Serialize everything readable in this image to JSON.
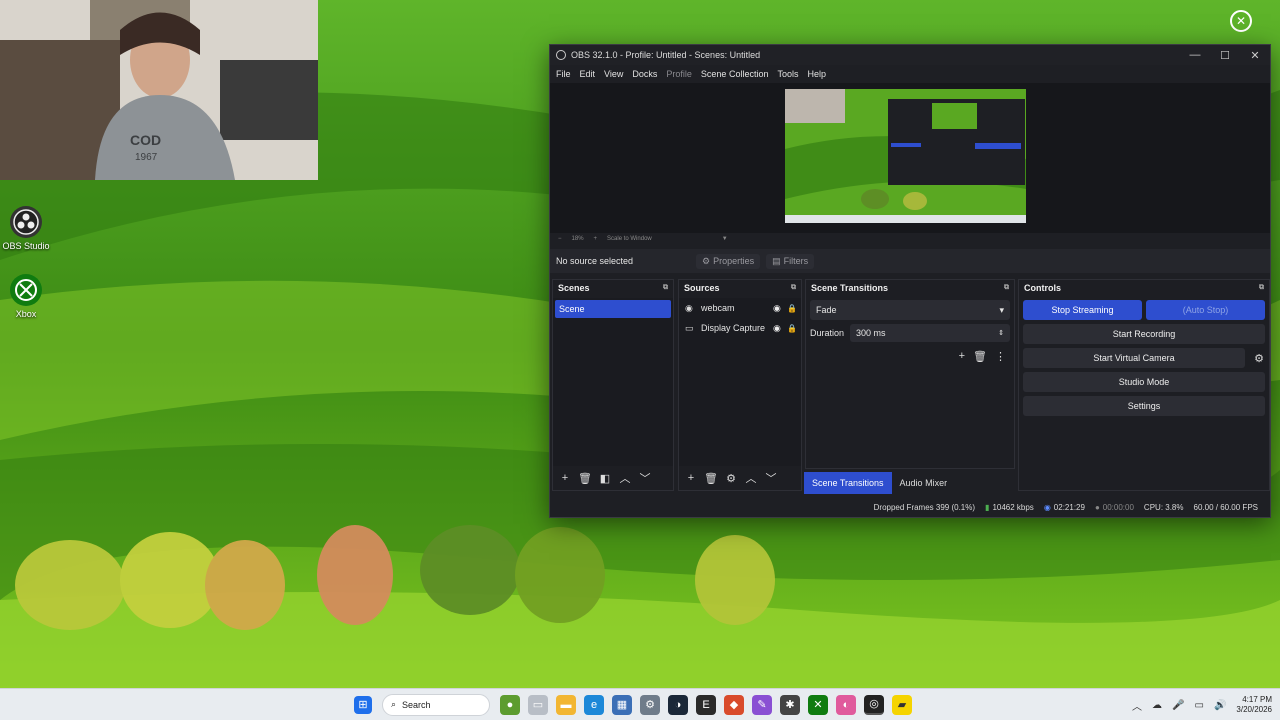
{
  "desktop": {
    "icons": [
      {
        "name": "OBS Studio"
      },
      {
        "name": "Xbox"
      }
    ]
  },
  "obs": {
    "title": "OBS 32.1.0 - Profile: Untitled - Scenes: Untitled",
    "menus": [
      "File",
      "Edit",
      "View",
      "Docks",
      "Profile",
      "Scene Collection",
      "Tools",
      "Help"
    ],
    "zoom": {
      "percent": "18%",
      "scale_label": "Scale to Window"
    },
    "no_source": "No source selected",
    "properties_label": "Properties",
    "filters_label": "Filters",
    "scenes": {
      "title": "Scenes",
      "items": [
        "Scene"
      ]
    },
    "sources": {
      "title": "Sources",
      "items": [
        "webcam",
        "Display Capture"
      ]
    },
    "transitions": {
      "title": "Scene Transitions",
      "selected": "Fade",
      "duration_label": "Duration",
      "duration_value": "300 ms"
    },
    "controls": {
      "title": "Controls",
      "stop_streaming": "Stop Streaming",
      "auto_stop": "(Auto Stop)",
      "start_recording": "Start Recording",
      "start_virtual_camera": "Start Virtual Camera",
      "studio_mode": "Studio Mode",
      "settings": "Settings"
    },
    "tabs": [
      "Scene Transitions",
      "Audio Mixer"
    ],
    "status": {
      "dropped_frames": "Dropped Frames 399 (0.1%)",
      "bitrate": "10462 kbps",
      "stream_time": "02:21:29",
      "rec_time": "00:00:00",
      "cpu": "CPU: 3.8%",
      "fps": "60.00 / 60.00 FPS"
    }
  },
  "taskbar": {
    "search_label": "Search",
    "time": "4:17 PM",
    "date": "3/20/2026"
  },
  "colors": {
    "accent": "#2e4ecf",
    "window_bg": "#1e1f24",
    "wallpaper": "#4a9a18"
  }
}
